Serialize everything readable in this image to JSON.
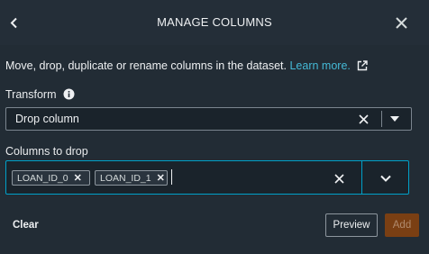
{
  "header": {
    "title": "MANAGE COLUMNS"
  },
  "description": {
    "text": "Move, drop, duplicate or rename columns in the dataset.",
    "link_text": "Learn more."
  },
  "transform": {
    "label": "Transform",
    "selected": "Drop column"
  },
  "columns_to_drop": {
    "label": "Columns to drop",
    "tokens": [
      "LOAN_ID_0",
      "LOAN_ID_1"
    ]
  },
  "footer": {
    "clear_label": "Clear",
    "preview_label": "Preview",
    "add_label": "Add"
  },
  "colors": {
    "background": "#222c35",
    "accent": "#00a1c9",
    "link": "#44b9d6",
    "add_button": "#7a3f13"
  },
  "icons": [
    "chevron-left-icon",
    "close-icon",
    "external-link-icon",
    "info-icon",
    "clear-icon",
    "caret-down-icon",
    "chevron-down-icon"
  ]
}
